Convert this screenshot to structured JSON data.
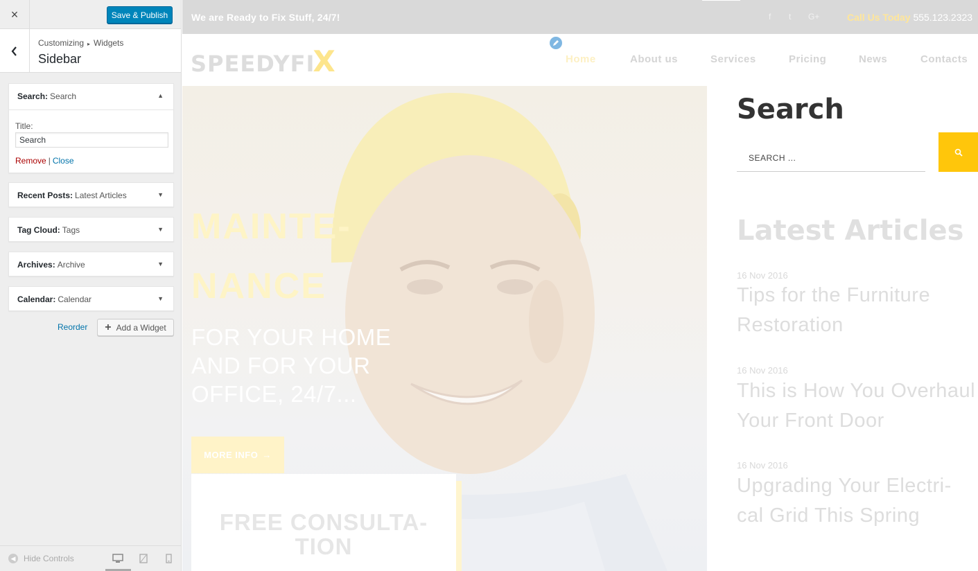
{
  "customizer": {
    "close_icon": "×",
    "save_label": "Save & Publish",
    "breadcrumb": {
      "root": "Customizing",
      "current": "Widgets"
    },
    "section_title": "Sidebar",
    "widgets": [
      {
        "type": "Search:",
        "name": "Search",
        "expanded": true,
        "title_label": "Title:",
        "title_value": "Search",
        "remove_label": "Remove",
        "close_label": "Close"
      },
      {
        "type": "Recent Posts:",
        "name": "Latest Articles",
        "expanded": false
      },
      {
        "type": "Tag Cloud:",
        "name": "Tags",
        "expanded": false
      },
      {
        "type": "Archives:",
        "name": "Archive",
        "expanded": false
      },
      {
        "type": "Calendar:",
        "name": "Calendar",
        "expanded": false
      }
    ],
    "reorder_label": "Reorder",
    "add_widget_label": "Add a Widget",
    "hide_controls_label": "Hide Controls",
    "devices": [
      "desktop-icon",
      "tablet-icon",
      "mobile-icon"
    ],
    "colors": {
      "primary": "#0085ba",
      "link": "#0073aa",
      "remove": "#a00"
    }
  },
  "preview": {
    "topbar": {
      "tagline": "We are Ready to Fix Stuff, 24/7!",
      "social": [
        "facebook-icon",
        "twitter-icon",
        "google-plus-icon"
      ],
      "social_glyphs": {
        "facebook": "f",
        "twitter": "t",
        "google": "G+"
      },
      "call_label": "Call Us Today",
      "phone": "555.123.2323"
    },
    "logo": {
      "text": "SPEEDYFI",
      "x": "X"
    },
    "nav": [
      "Home",
      "About us",
      "Services",
      "Pricing",
      "News",
      "Contacts"
    ],
    "hero": {
      "title_line1": "MAINTE-",
      "title_line2": "NANCE",
      "subtitle": "FOR YOUR HOME AND FOR YOUR OFFICE, 24/7...",
      "button": "MORE INFO",
      "button_arrow": "→",
      "card_title_line1": "FREE CONSULTA-",
      "card_title_line2": "TION"
    },
    "sidebar": {
      "search_heading": "Search",
      "search_placeholder": "SEARCH ...",
      "latest_heading": "Latest Articles",
      "posts": [
        {
          "date": "16 Nov 2016",
          "title_line1": "Tips for the Furniture",
          "title_line2": "Restoration"
        },
        {
          "date": "16 Nov 2016",
          "title_line1": "This is How You Overhaul",
          "title_line2": "Your Front Door"
        },
        {
          "date": "16 Nov 2016",
          "title_line1": "Upgrading Your Electri-",
          "title_line2": "cal Grid This Spring"
        }
      ]
    },
    "colors": {
      "accent": "#ffc60b",
      "topbar": "#d9d9d9"
    }
  }
}
